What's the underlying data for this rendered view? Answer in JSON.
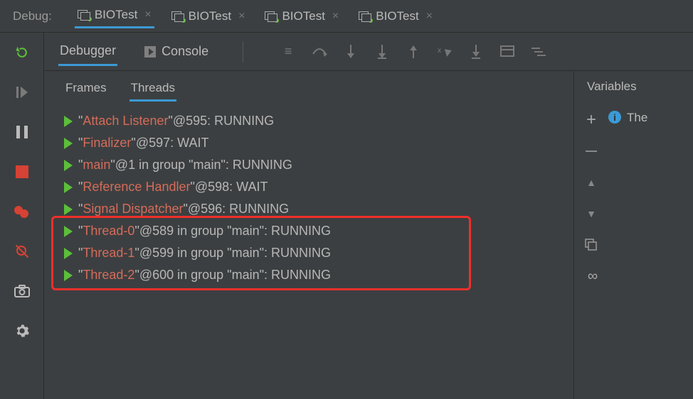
{
  "top": {
    "debugLabel": "Debug:",
    "tabs": [
      {
        "label": "BIOTest",
        "active": true
      },
      {
        "label": "BIOTest",
        "active": false
      },
      {
        "label": "BIOTest",
        "active": false
      },
      {
        "label": "BIOTest",
        "active": false
      }
    ]
  },
  "subTabs": {
    "debugger": "Debugger",
    "console": "Console"
  },
  "frameTabs": {
    "frames": "Frames",
    "threads": "Threads"
  },
  "threads": [
    {
      "name": "Attach Listener",
      "suffix": "@595: RUNNING"
    },
    {
      "name": "Finalizer",
      "suffix": "@597: WAIT"
    },
    {
      "name": "main",
      "suffix": "@1 in group \"main\": RUNNING"
    },
    {
      "name": "Reference Handler",
      "suffix": "@598: WAIT"
    },
    {
      "name": "Signal Dispatcher",
      "suffix": "@596: RUNNING"
    },
    {
      "name": "Thread-0",
      "suffix": "@589 in group \"main\": RUNNING"
    },
    {
      "name": "Thread-1",
      "suffix": "@599 in group \"main\": RUNNING"
    },
    {
      "name": "Thread-2",
      "suffix": "@600 in group \"main\": RUNNING"
    }
  ],
  "highlight": {
    "startIndex": 5,
    "endIndex": 7
  },
  "variables": {
    "header": "Variables",
    "message": "The"
  }
}
